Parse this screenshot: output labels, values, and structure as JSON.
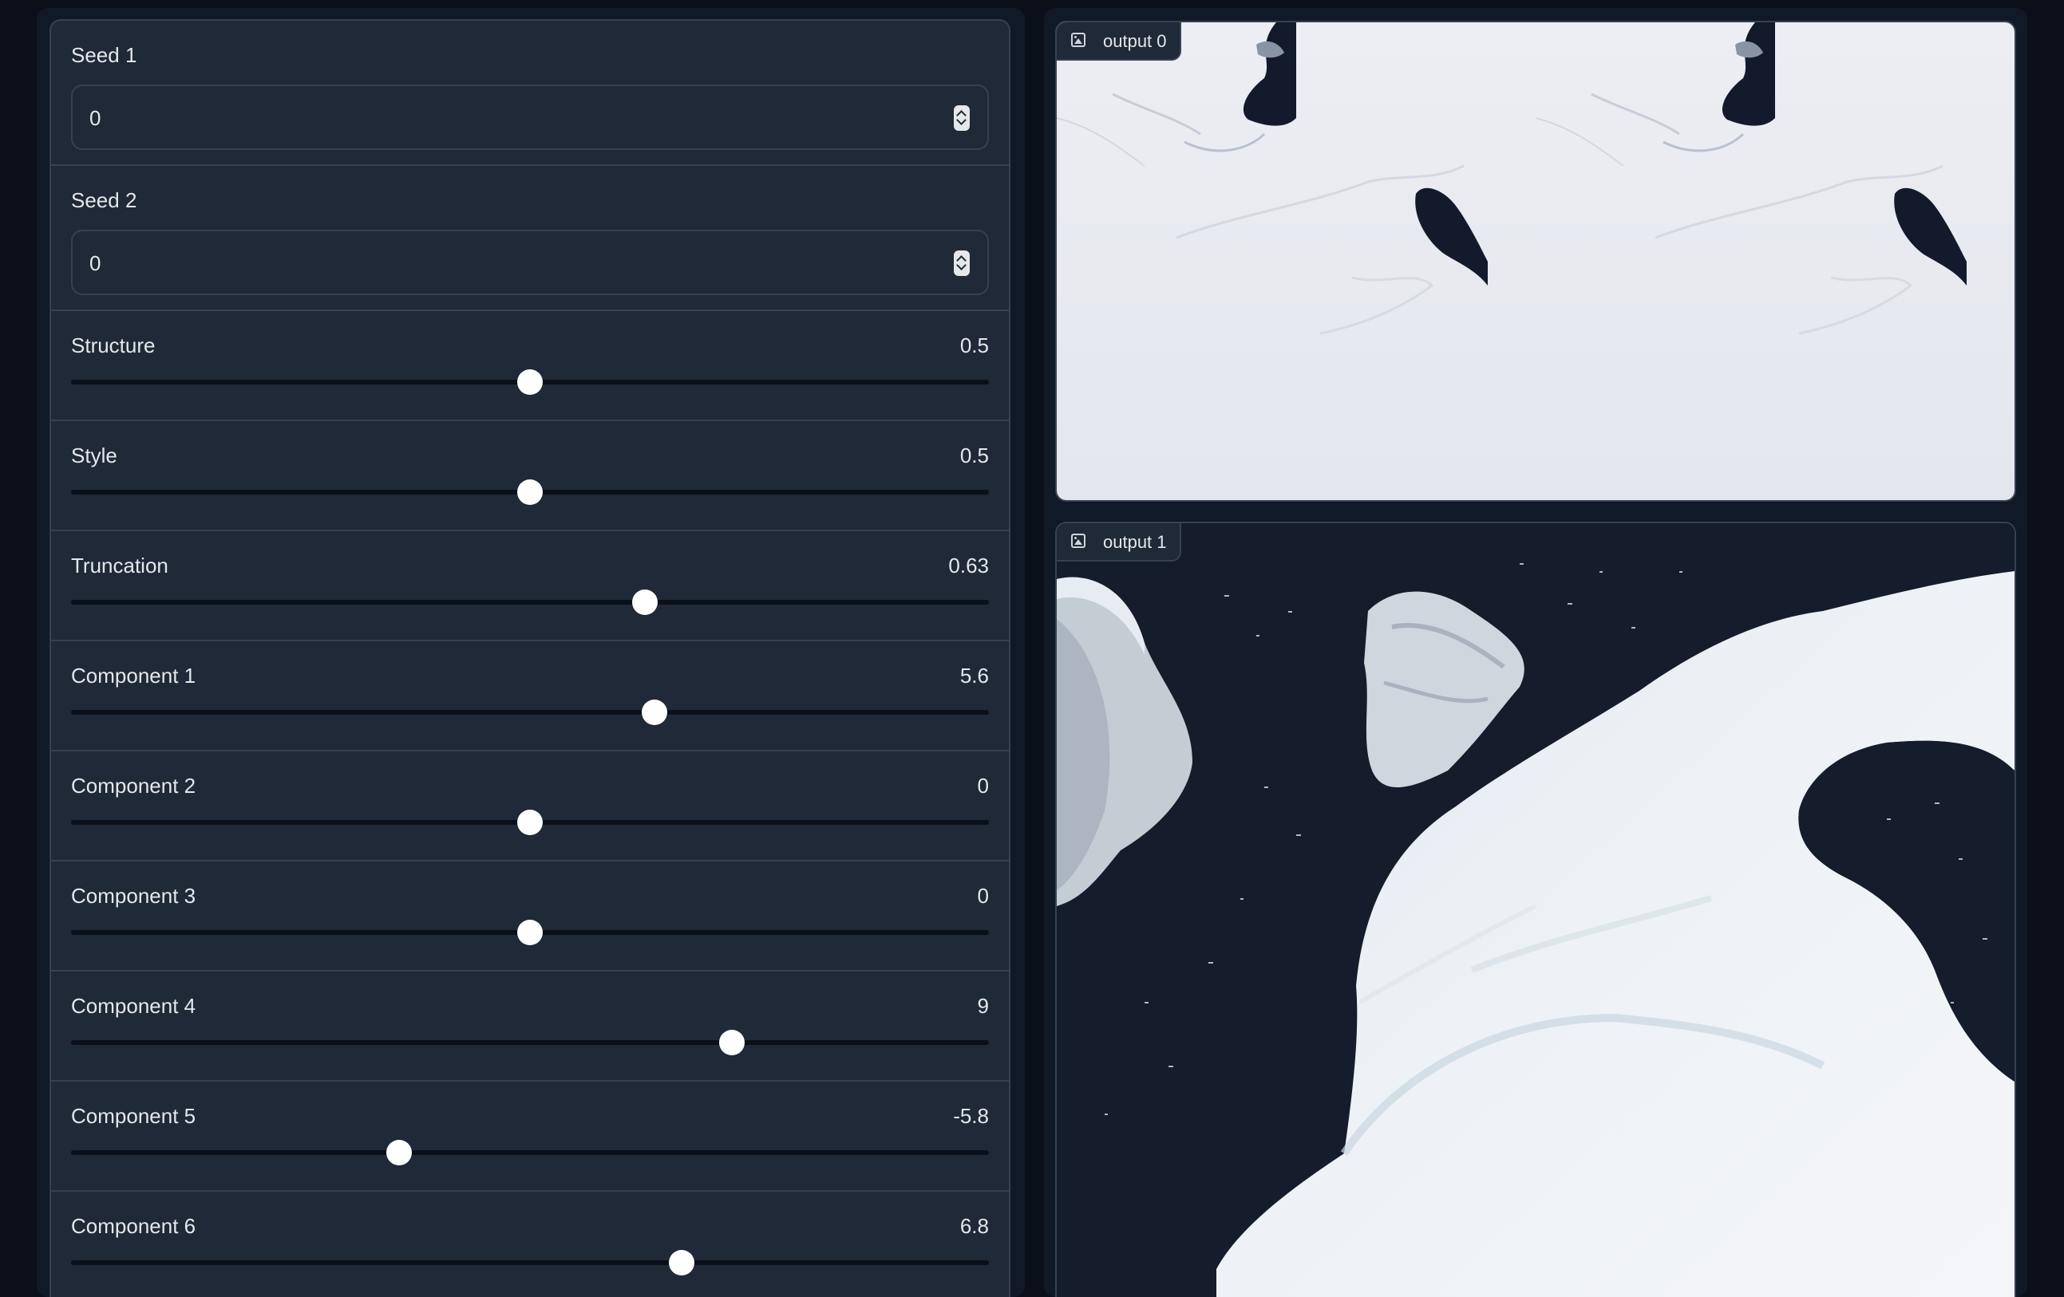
{
  "inputs": {
    "seed1": {
      "label": "Seed 1",
      "value": "0"
    },
    "seed2": {
      "label": "Seed 2",
      "value": "0"
    }
  },
  "sliders": [
    {
      "label": "Structure",
      "value": "0.5",
      "fraction": 0.5
    },
    {
      "label": "Style",
      "value": "0.5",
      "fraction": 0.5
    },
    {
      "label": "Truncation",
      "value": "0.63",
      "fraction": 0.625
    },
    {
      "label": "Component 1",
      "value": "5.6",
      "fraction": 0.636
    },
    {
      "label": "Component 2",
      "value": "0",
      "fraction": 0.5
    },
    {
      "label": "Component 3",
      "value": "0",
      "fraction": 0.5
    },
    {
      "label": "Component 4",
      "value": "9",
      "fraction": 0.72
    },
    {
      "label": "Component 5",
      "value": "-5.8",
      "fraction": 0.357
    },
    {
      "label": "Component 6",
      "value": "6.8",
      "fraction": 0.665
    }
  ],
  "outputs": [
    {
      "label": "output 0",
      "content": "satellite image of ice sheet"
    },
    {
      "label": "output 1",
      "content": "satellite image of ice sheet and dark water"
    }
  ],
  "colors": {
    "page_bg": "#0b0f19",
    "panel_bg": "#111827",
    "block_bg": "#1f2937",
    "border": "#374151",
    "track": "#0b0f19",
    "thumb": "#ffffff"
  }
}
